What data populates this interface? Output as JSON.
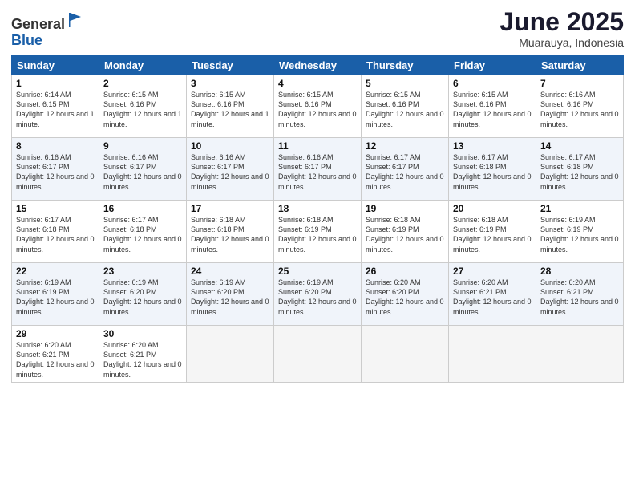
{
  "logo": {
    "general": "General",
    "blue": "Blue"
  },
  "title": "June 2025",
  "location": "Muarauya, Indonesia",
  "days": [
    "Sunday",
    "Monday",
    "Tuesday",
    "Wednesday",
    "Thursday",
    "Friday",
    "Saturday"
  ],
  "weeks": [
    [
      {
        "day": "1",
        "sunrise": "6:14 AM",
        "sunset": "6:15 PM",
        "daylight": "12 hours and 1 minute."
      },
      {
        "day": "2",
        "sunrise": "6:15 AM",
        "sunset": "6:16 PM",
        "daylight": "12 hours and 1 minute."
      },
      {
        "day": "3",
        "sunrise": "6:15 AM",
        "sunset": "6:16 PM",
        "daylight": "12 hours and 1 minute."
      },
      {
        "day": "4",
        "sunrise": "6:15 AM",
        "sunset": "6:16 PM",
        "daylight": "12 hours and 0 minutes."
      },
      {
        "day": "5",
        "sunrise": "6:15 AM",
        "sunset": "6:16 PM",
        "daylight": "12 hours and 0 minutes."
      },
      {
        "day": "6",
        "sunrise": "6:15 AM",
        "sunset": "6:16 PM",
        "daylight": "12 hours and 0 minutes."
      },
      {
        "day": "7",
        "sunrise": "6:16 AM",
        "sunset": "6:16 PM",
        "daylight": "12 hours and 0 minutes."
      }
    ],
    [
      {
        "day": "8",
        "sunrise": "6:16 AM",
        "sunset": "6:17 PM",
        "daylight": "12 hours and 0 minutes."
      },
      {
        "day": "9",
        "sunrise": "6:16 AM",
        "sunset": "6:17 PM",
        "daylight": "12 hours and 0 minutes."
      },
      {
        "day": "10",
        "sunrise": "6:16 AM",
        "sunset": "6:17 PM",
        "daylight": "12 hours and 0 minutes."
      },
      {
        "day": "11",
        "sunrise": "6:16 AM",
        "sunset": "6:17 PM",
        "daylight": "12 hours and 0 minutes."
      },
      {
        "day": "12",
        "sunrise": "6:17 AM",
        "sunset": "6:17 PM",
        "daylight": "12 hours and 0 minutes."
      },
      {
        "day": "13",
        "sunrise": "6:17 AM",
        "sunset": "6:18 PM",
        "daylight": "12 hours and 0 minutes."
      },
      {
        "day": "14",
        "sunrise": "6:17 AM",
        "sunset": "6:18 PM",
        "daylight": "12 hours and 0 minutes."
      }
    ],
    [
      {
        "day": "15",
        "sunrise": "6:17 AM",
        "sunset": "6:18 PM",
        "daylight": "12 hours and 0 minutes."
      },
      {
        "day": "16",
        "sunrise": "6:17 AM",
        "sunset": "6:18 PM",
        "daylight": "12 hours and 0 minutes."
      },
      {
        "day": "17",
        "sunrise": "6:18 AM",
        "sunset": "6:18 PM",
        "daylight": "12 hours and 0 minutes."
      },
      {
        "day": "18",
        "sunrise": "6:18 AM",
        "sunset": "6:19 PM",
        "daylight": "12 hours and 0 minutes."
      },
      {
        "day": "19",
        "sunrise": "6:18 AM",
        "sunset": "6:19 PM",
        "daylight": "12 hours and 0 minutes."
      },
      {
        "day": "20",
        "sunrise": "6:18 AM",
        "sunset": "6:19 PM",
        "daylight": "12 hours and 0 minutes."
      },
      {
        "day": "21",
        "sunrise": "6:19 AM",
        "sunset": "6:19 PM",
        "daylight": "12 hours and 0 minutes."
      }
    ],
    [
      {
        "day": "22",
        "sunrise": "6:19 AM",
        "sunset": "6:19 PM",
        "daylight": "12 hours and 0 minutes."
      },
      {
        "day": "23",
        "sunrise": "6:19 AM",
        "sunset": "6:20 PM",
        "daylight": "12 hours and 0 minutes."
      },
      {
        "day": "24",
        "sunrise": "6:19 AM",
        "sunset": "6:20 PM",
        "daylight": "12 hours and 0 minutes."
      },
      {
        "day": "25",
        "sunrise": "6:19 AM",
        "sunset": "6:20 PM",
        "daylight": "12 hours and 0 minutes."
      },
      {
        "day": "26",
        "sunrise": "6:20 AM",
        "sunset": "6:20 PM",
        "daylight": "12 hours and 0 minutes."
      },
      {
        "day": "27",
        "sunrise": "6:20 AM",
        "sunset": "6:21 PM",
        "daylight": "12 hours and 0 minutes."
      },
      {
        "day": "28",
        "sunrise": "6:20 AM",
        "sunset": "6:21 PM",
        "daylight": "12 hours and 0 minutes."
      }
    ],
    [
      {
        "day": "29",
        "sunrise": "6:20 AM",
        "sunset": "6:21 PM",
        "daylight": "12 hours and 0 minutes."
      },
      {
        "day": "30",
        "sunrise": "6:20 AM",
        "sunset": "6:21 PM",
        "daylight": "12 hours and 0 minutes."
      },
      null,
      null,
      null,
      null,
      null
    ]
  ]
}
